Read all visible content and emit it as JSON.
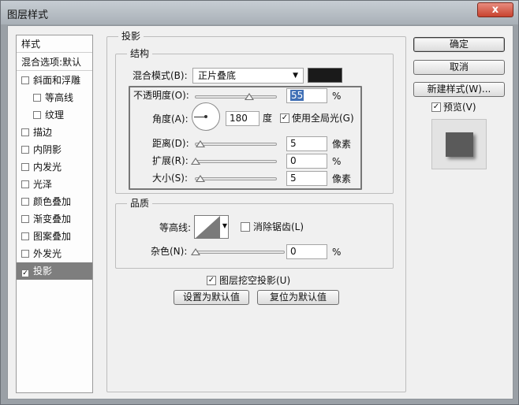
{
  "window": {
    "title": "图层样式",
    "close_glyph": "x"
  },
  "style_list": {
    "header": "样式",
    "blend_default": "混合选项:默认",
    "items": [
      {
        "label": "斜面和浮雕",
        "checked": false,
        "sub": false
      },
      {
        "label": "等高线",
        "checked": false,
        "sub": true
      },
      {
        "label": "纹理",
        "checked": false,
        "sub": true
      },
      {
        "label": "描边",
        "checked": false,
        "sub": false
      },
      {
        "label": "内阴影",
        "checked": false,
        "sub": false
      },
      {
        "label": "内发光",
        "checked": false,
        "sub": false
      },
      {
        "label": "光泽",
        "checked": false,
        "sub": false
      },
      {
        "label": "颜色叠加",
        "checked": false,
        "sub": false
      },
      {
        "label": "渐变叠加",
        "checked": false,
        "sub": false
      },
      {
        "label": "图案叠加",
        "checked": false,
        "sub": false
      },
      {
        "label": "外发光",
        "checked": false,
        "sub": false
      },
      {
        "label": "投影",
        "checked": true,
        "sub": false,
        "selected": true
      }
    ]
  },
  "drop_shadow": {
    "section_title": "投影",
    "structure": {
      "title": "结构",
      "blend_mode_label": "混合模式(B):",
      "blend_mode_value": "正片叠底",
      "shadow_color": "#1a1a1a",
      "opacity_label": "不透明度(O):",
      "opacity_value": "55",
      "opacity_unit": "%",
      "angle_label": "角度(A):",
      "angle_value": "180",
      "angle_unit": "度",
      "global_light_label": "使用全局光(G)",
      "global_light_checked": true,
      "distance_label": "距离(D):",
      "distance_value": "5",
      "distance_unit": "像素",
      "spread_label": "扩展(R):",
      "spread_value": "0",
      "spread_unit": "%",
      "size_label": "大小(S):",
      "size_value": "5",
      "size_unit": "像素"
    },
    "quality": {
      "title": "品质",
      "contour_label": "等高线:",
      "anti_alias_label": "消除锯齿(L)",
      "anti_alias_checked": false,
      "noise_label": "杂色(N):",
      "noise_value": "0",
      "noise_unit": "%"
    },
    "knockout_label": "图层挖空投影(U)",
    "knockout_checked": true,
    "make_default_label": "设置为默认值",
    "reset_default_label": "复位为默认值"
  },
  "buttons": {
    "ok": "确定",
    "cancel": "取消",
    "new_style": "新建样式(W)...",
    "preview_label": "预览(V)",
    "preview_checked": true
  },
  "colors": {
    "selected_item_bg": "#7e7e7e",
    "highlight_selection": "#3f6fb5",
    "preview_swatch": "#5a5a5a"
  }
}
